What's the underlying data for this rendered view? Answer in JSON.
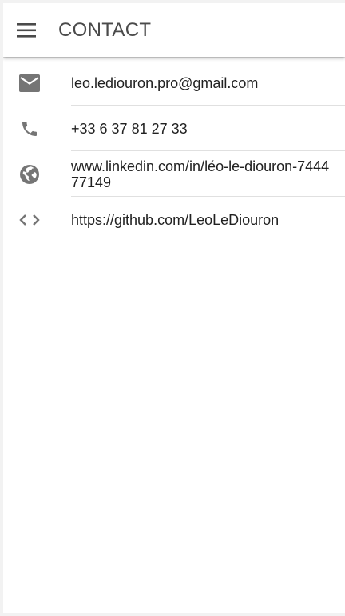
{
  "app_bar": {
    "title": "CONTACT",
    "menu_icon": "menu-icon"
  },
  "contacts": [
    {
      "icon": "email-icon",
      "text": "leo.lediouron.pro@gmail.com"
    },
    {
      "icon": "phone-icon",
      "text": "+33 6 37 81 27 33"
    },
    {
      "icon": "globe-icon",
      "text": "www.linkedin.com/in/léo-le-diouron-744477149"
    },
    {
      "icon": "code-icon",
      "text": "https://github.com/LeoLeDiouron"
    }
  ],
  "colors": {
    "icon": "#757575",
    "text": "#212121",
    "title": "#4a4a4a",
    "divider": "#e0e0e0"
  }
}
